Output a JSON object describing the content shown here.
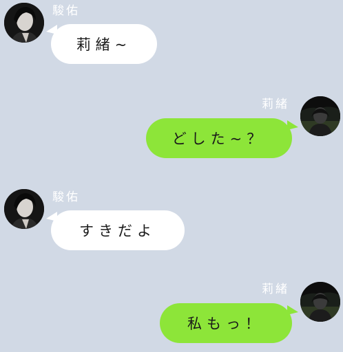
{
  "colors": {
    "background": "#d1d9e5",
    "incoming_bubble": "#ffffff",
    "outgoing_bubble": "#8de539",
    "sender_name": "#ffffff"
  },
  "messages": [
    {
      "direction": "incoming",
      "sender": "駿佑",
      "avatar": "avatar-shunsuke-icon",
      "text": "莉緒~"
    },
    {
      "direction": "outgoing",
      "sender": "莉緒",
      "avatar": "avatar-rio-icon",
      "text": "どした~？"
    },
    {
      "direction": "incoming",
      "sender": "駿佑",
      "avatar": "avatar-shunsuke-icon",
      "text": "すきだよ"
    },
    {
      "direction": "outgoing",
      "sender": "莉緒",
      "avatar": "avatar-rio-icon",
      "text": "私もっ！"
    }
  ]
}
